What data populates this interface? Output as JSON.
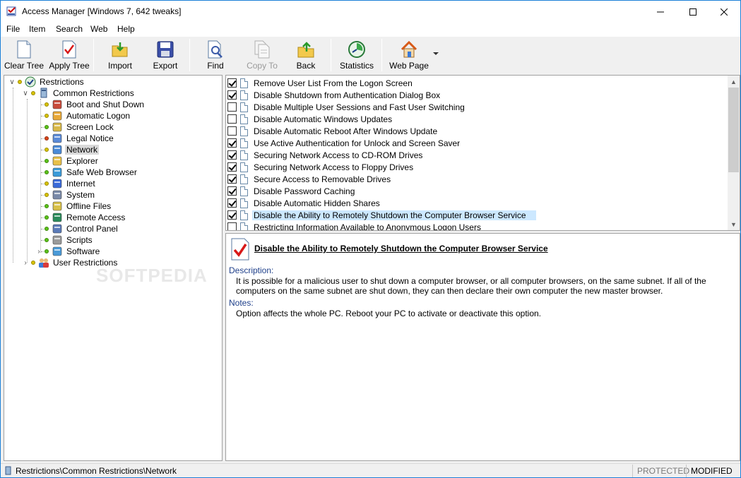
{
  "window": {
    "title": "Access Manager [Windows 7, 642 tweaks]",
    "accent": "#1c80d8"
  },
  "menu": [
    "File",
    "Item",
    "Search",
    "Web",
    "Help"
  ],
  "toolbar": {
    "clear_tree": "Clear Tree",
    "apply_tree": "Apply Tree",
    "import": "Import",
    "export": "Export",
    "find": "Find",
    "copy_to": "Copy To",
    "back": "Back",
    "statistics": "Statistics",
    "web_page": "Web Page"
  },
  "tree": {
    "root": "Restrictions",
    "common": "Common Restrictions",
    "items": [
      {
        "label": "Boot and Shut Down",
        "status": "yellow",
        "icon": "boot-icon"
      },
      {
        "label": "Automatic Logon",
        "status": "yellow",
        "icon": "logon-icon"
      },
      {
        "label": "Screen Lock",
        "status": "green",
        "icon": "screen-lock-icon"
      },
      {
        "label": "Legal Notice",
        "status": "red",
        "icon": "legal-notice-icon"
      },
      {
        "label": "Network",
        "status": "yellow",
        "icon": "network-icon"
      },
      {
        "label": "Explorer",
        "status": "green",
        "icon": "explorer-icon"
      },
      {
        "label": "Safe Web Browser",
        "status": "green",
        "icon": "globe-icon"
      },
      {
        "label": "Internet",
        "status": "yellow",
        "icon": "internet-icon"
      },
      {
        "label": "System",
        "status": "yellow",
        "icon": "system-icon"
      },
      {
        "label": "Offline Files",
        "status": "green",
        "icon": "offline-files-icon"
      },
      {
        "label": "Remote Access",
        "status": "green",
        "icon": "remote-access-icon"
      },
      {
        "label": "Control Panel",
        "status": "green",
        "icon": "control-panel-icon"
      },
      {
        "label": "Scripts",
        "status": "green",
        "icon": "scripts-icon"
      },
      {
        "label": "Software",
        "status": "green",
        "icon": "software-icon"
      }
    ],
    "user": "User Restrictions"
  },
  "list": [
    {
      "label": "Remove User List From the Logon Screen",
      "checked": true
    },
    {
      "label": "Disable Shutdown from Authentication Dialog Box",
      "checked": true
    },
    {
      "label": "Disable Multiple User Sessions and Fast User Switching",
      "checked": false
    },
    {
      "label": "Disable Automatic Windows Updates",
      "checked": false
    },
    {
      "label": "Disable Automatic Reboot After Windows Update",
      "checked": false
    },
    {
      "label": "Use Active Authentication for Unlock and Screen Saver",
      "checked": true
    },
    {
      "label": "Securing Network Access to CD-ROM Drives",
      "checked": true
    },
    {
      "label": "Securing Network Access to Floppy Drives",
      "checked": true
    },
    {
      "label": "Secure Access to Removable Drives",
      "checked": true
    },
    {
      "label": "Disable Password Caching",
      "checked": true
    },
    {
      "label": "Disable Automatic Hidden Shares",
      "checked": true
    },
    {
      "label": "Disable the Ability to Remotely Shutdown the Computer Browser Service",
      "checked": true
    },
    {
      "label": "Restricting Information Available to Anonymous Logon Users",
      "checked": false
    }
  ],
  "detail": {
    "title": "Disable the Ability to Remotely Shutdown the Computer Browser Service",
    "description_label": "Description:",
    "description": "It is possible for a malicious user to shut down a computer browser, or all computer browsers, on the same subnet. If all of the computers on the same subnet are shut down, they can then declare their own computer the new master browser.",
    "notes_label": "Notes:",
    "notes": "Option affects the whole PC. Reboot your PC to activate or deactivate this option."
  },
  "status": {
    "path": "Restrictions\\Common Restrictions\\Network",
    "protected": "PROTECTED",
    "modified": "MODIFIED"
  },
  "watermark": "SOFTPEDIA"
}
